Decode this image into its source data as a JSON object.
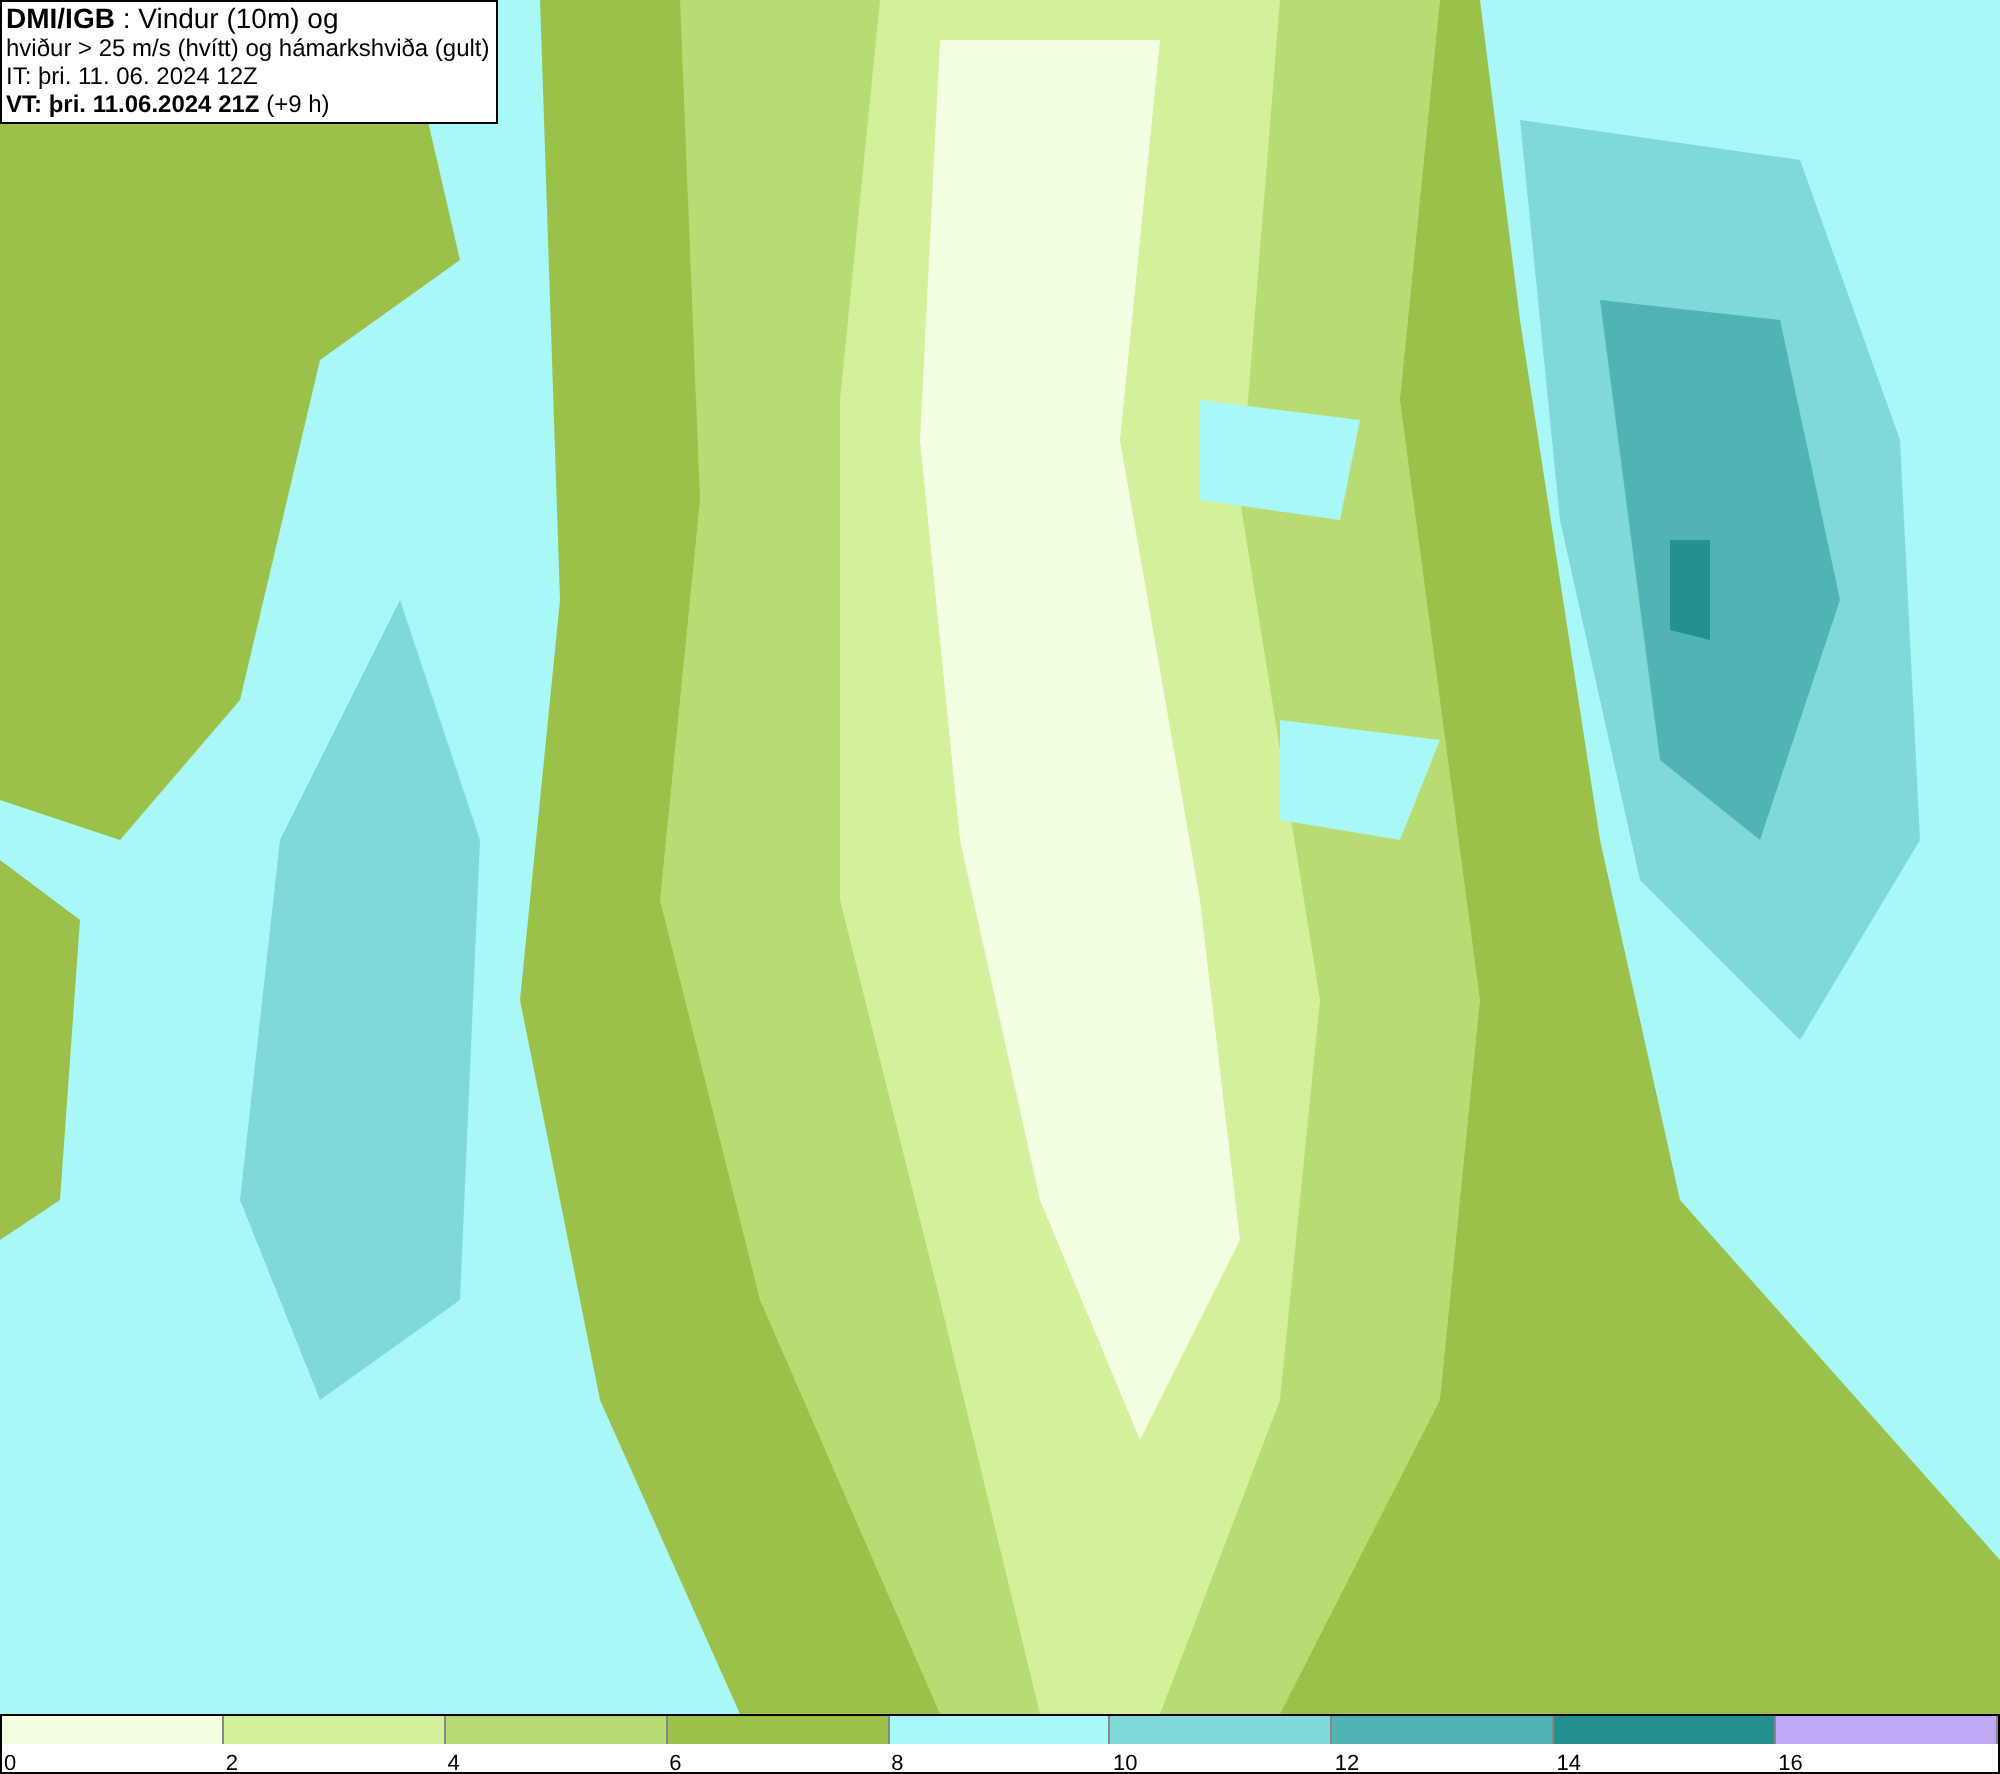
{
  "header": {
    "lines": [
      "**DMI/IGB** : Vindur (10m) og",
      "hviður > 25 m/s (hvítt) og hámarkshviða (gult)",
      "IT: þri. 11. 06. 2024 12Z",
      "**VT: þri. 11.06.2024 21Z** (+9 h)"
    ]
  },
  "legend": {
    "bins": [
      {
        "label": "0",
        "color": "#f2ffe0"
      },
      {
        "label": "2",
        "color": "#d4f09a"
      },
      {
        "label": "4",
        "color": "#b8dc74"
      },
      {
        "label": "6",
        "color": "#9bc14a"
      },
      {
        "label": "8",
        "color": "#a8f8f8"
      },
      {
        "label": "10",
        "color": "#80d8d8"
      },
      {
        "label": "12",
        "color": "#50b4b4"
      },
      {
        "label": "14",
        "color": "#259090"
      },
      {
        "label": "16",
        "color": "#c0aaf8"
      }
    ]
  }
}
